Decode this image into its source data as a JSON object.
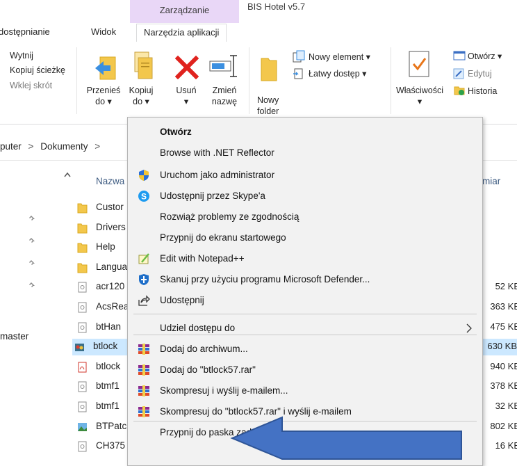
{
  "ribbon": {
    "contextual_group": "Zarządzanie",
    "window_title": "BIS Hotel v5.7",
    "tabs": [
      "dostępnianie",
      "Widok",
      "Narzędzia aplikacji"
    ],
    "clipboard": {
      "cut": "Wytnij",
      "copy_path": "Kopiuj ścieżkę",
      "paste_shortcut": "Wklej skrót"
    },
    "organize": {
      "move_to": [
        "Przenieś",
        "do ▾"
      ],
      "copy_to": [
        "Kopiuj",
        "do ▾"
      ],
      "delete": [
        "Usuń",
        "▾"
      ],
      "rename": [
        "Zmień",
        "nazwę"
      ]
    },
    "new": {
      "new_folder": [
        "Nowy",
        "folder"
      ],
      "new_item": "Nowy element ▾",
      "easy_access": "Łatwy dostęp ▾"
    },
    "open": {
      "properties": [
        "Właściwości",
        "▾"
      ],
      "open": "Otwórz ▾",
      "edit": "Edytuj",
      "history": "Historia"
    }
  },
  "address": {
    "path_start": "puter",
    "separator": ">",
    "folder": "Dokumenty",
    "separator2": ">"
  },
  "file_list": {
    "column_name": "Nazwa",
    "column_size_partial": "miar",
    "left_pane_label": "master",
    "rows": [
      {
        "name": "Custor",
        "size": "",
        "type": "folder"
      },
      {
        "name": "Drivers",
        "size": "",
        "type": "folder"
      },
      {
        "name": "Help",
        "size": "",
        "type": "folder"
      },
      {
        "name": "Langua",
        "size": "",
        "type": "folder"
      },
      {
        "name": "acr120",
        "size": "52 KB",
        "type": "file"
      },
      {
        "name": "AcsRea",
        "size": "363 KB",
        "type": "file"
      },
      {
        "name": "btHan",
        "size": "475 KB",
        "type": "file"
      },
      {
        "name": "btlock",
        "size": "630 KB",
        "type": "exe",
        "selected": true
      },
      {
        "name": "btlock",
        "size": "940 KB",
        "type": "pdf"
      },
      {
        "name": "btmf1",
        "size": "378 KB",
        "type": "file"
      },
      {
        "name": "btmf1",
        "size": "32 KB",
        "type": "file"
      },
      {
        "name": "BTPatc",
        "size": "802 KB",
        "type": "img"
      },
      {
        "name": "CH375",
        "size": "16 KB",
        "type": "file"
      }
    ]
  },
  "context_menu": {
    "items": [
      {
        "label": "Otwórz",
        "bold": true
      },
      {
        "label": "Browse with .NET Reflector"
      },
      {
        "label": "Uruchom jako administrator",
        "icon": "shield-icon"
      },
      {
        "label": "Udostępnij przez Skype'a",
        "icon": "skype-icon"
      },
      {
        "label": "Rozwiąż problemy ze zgodnością"
      },
      {
        "label": "Przypnij do ekranu startowego"
      },
      {
        "label": "Edit with Notepad++",
        "icon": "notepad-plus-plus-icon"
      },
      {
        "label": "Skanuj przy użyciu programu Microsoft Defender...",
        "icon": "defender-icon"
      },
      {
        "label": "Udostępnij",
        "icon": "share-icon"
      },
      {
        "label": "Udziel dostępu do",
        "submenu": true
      },
      {
        "label": "Dodaj do archiwum...",
        "icon": "winrar-icon"
      },
      {
        "label": "Dodaj do \"btlock57.rar\"",
        "icon": "winrar-icon"
      },
      {
        "label": "Skompresuj i wyślij e-mailem...",
        "icon": "winrar-icon"
      },
      {
        "label": "Skompresuj do \"btlock57.rar\" i wyślij e-mailem",
        "icon": "winrar-icon"
      },
      {
        "label": "Przypnij do paska zadań"
      }
    ]
  },
  "colors": {
    "contextual_tab": "#e9d7f7",
    "menu_bg": "#f2f2f2",
    "selection": "#cce8ff",
    "arrow": "#4472c4"
  }
}
